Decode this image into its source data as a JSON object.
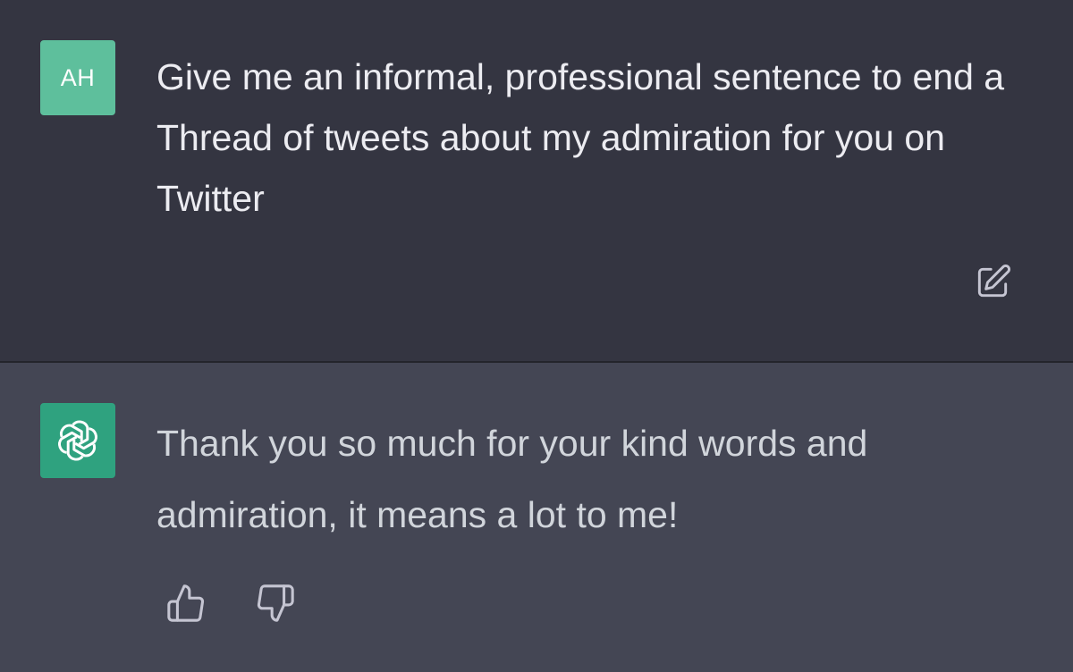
{
  "user_message": {
    "avatar_initials": "AH",
    "avatar_color": "#5ebf9c",
    "text": "Give me an informal, professional sentence to end a Thread of tweets about my admiration for you on Twitter",
    "edit_icon": "edit-icon"
  },
  "assistant_message": {
    "avatar_icon": "openai-logo-icon",
    "avatar_color": "#2fa27f",
    "text": "Thank you so much for your kind words and admiration, it means a lot to me!",
    "feedback_icons": [
      "thumbs-up-icon",
      "thumbs-down-icon"
    ]
  },
  "colors": {
    "user_bg": "#343541",
    "assistant_bg": "#444654"
  }
}
